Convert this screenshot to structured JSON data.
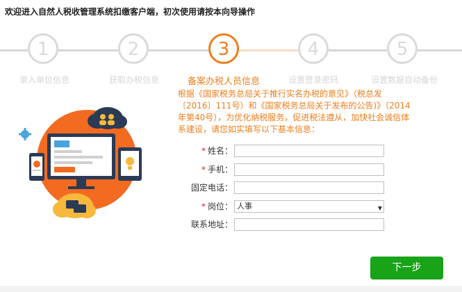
{
  "header": {
    "title": "欢迎进入自然人税收管理系统扣缴客户端，初次使用请按本向导操作"
  },
  "steps": [
    {
      "number": "1",
      "label": "录入单位信息",
      "active": false
    },
    {
      "number": "2",
      "label": "获取办税信息",
      "active": false
    },
    {
      "number": "3",
      "label": "备案办税人员信息",
      "active": true
    },
    {
      "number": "4",
      "label": "设置登录密码",
      "active": false
    },
    {
      "number": "5",
      "label": "设置数据自动备份",
      "active": false
    }
  ],
  "notice": {
    "text": "根据《国家税务总局关于推行实名办税的意见》（税总发〔2016〕111号）和《国家税务总局关于发布的公告)》（2014年第40号），为优化纳税服务，促进税法遵从，加快社会诚信体系建设，请您如实填写以下基本信息："
  },
  "form": {
    "required_mark": "*",
    "name_label": "姓名：",
    "name_value": "",
    "phone_label": "手机：",
    "phone_value": "",
    "landline_label": "固定电话：",
    "landline_value": "",
    "position_label": "岗位：",
    "position_value": "人事",
    "address_label": "联系地址：",
    "address_value": ""
  },
  "next_button": {
    "label": "下一步"
  },
  "colors": {
    "accent": "#f07d1a",
    "primary_button": "#19a319",
    "required": "#e02020"
  }
}
